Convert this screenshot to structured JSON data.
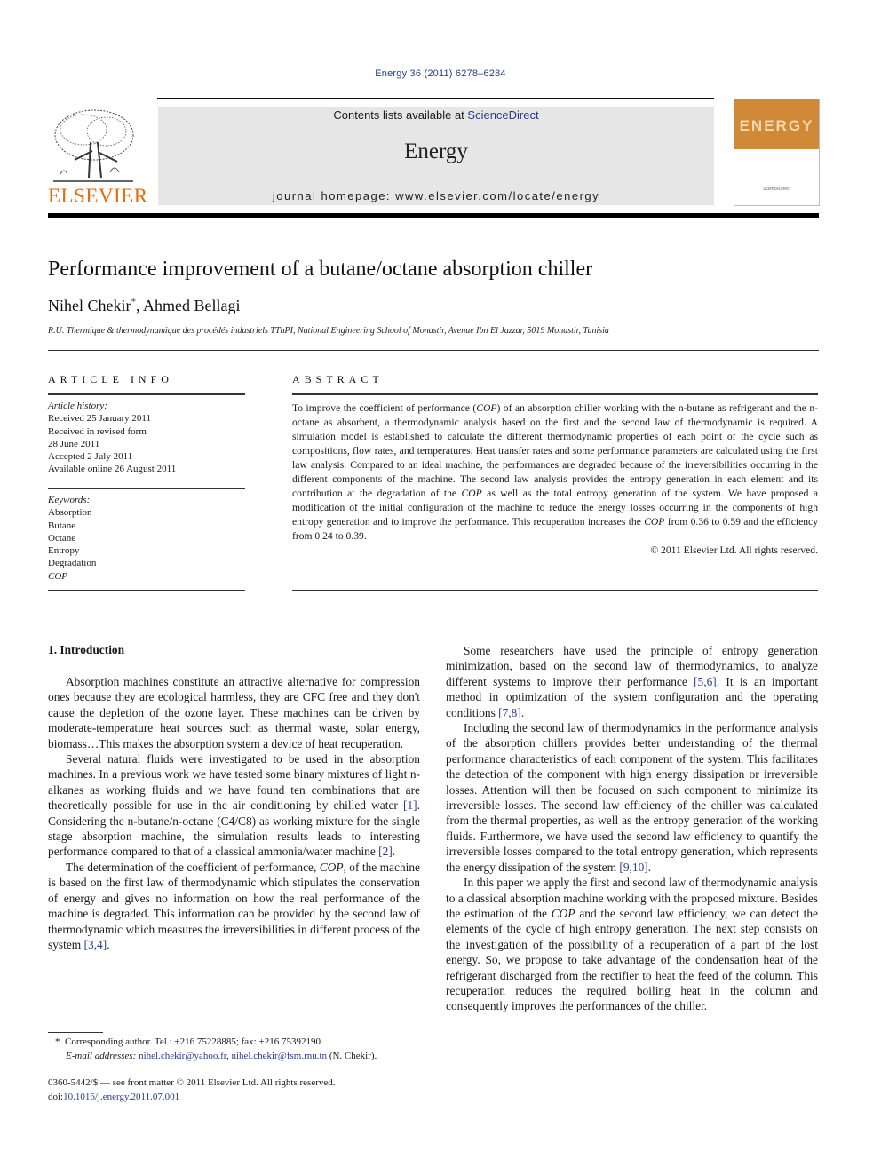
{
  "header": {
    "citation": "Energy 36 (2011) 6278–6284",
    "contents_prefix": "Contents lists available at ",
    "contents_link": "ScienceDirect",
    "journal_name": "Energy",
    "homepage": "journal homepage: www.elsevier.com/locate/energy",
    "publisher_logo_text": "ELSEVIER",
    "cover_title": "ENERGY"
  },
  "article": {
    "title": "Performance improvement of a butane/octane absorption chiller",
    "authors": [
      {
        "name": "Nihel Chekir",
        "mark": "*"
      },
      {
        "name": "Ahmed Bellagi",
        "mark": ""
      }
    ],
    "author_separator": ", ",
    "affiliation": "R.U. Thermique & thermodynamique des procédés industriels TThPI, National Engineering School of Monastir, Avenue Ibn El Jazzar, 5019 Monastir, Tunisia"
  },
  "article_info": {
    "heading": "ARTICLE INFO",
    "history_label": "Article history:",
    "history": [
      "Received 25 January 2011",
      "Received in revised form",
      "28 June 2011",
      "Accepted 2 July 2011",
      "Available online 26 August 2011"
    ],
    "keywords_label": "Keywords:",
    "keywords": [
      "Absorption",
      "Butane",
      "Octane",
      "Entropy",
      "Degradation",
      "COP"
    ]
  },
  "abstract": {
    "heading": "ABSTRACT",
    "parts": [
      "To improve the coefficient of performance (",
      "COP",
      ") of an absorption chiller working with the n-butane as refrigerant and the n-octane as absorbent, a thermodynamic analysis based on the first and the second law of thermodynamic is required. A simulation model is established to calculate the different ther­modynamic properties of each point of the cycle such as compositions, flow rates, and temperatures. Heat transfer rates and some performance parameters are calculated using the first law analysis. Compared to an ideal machine, the performances are degraded because of the irreversibilities occurring in the different components of the machine. The second law analysis provides the entropy generation in each element and its contribution at the degradation of the ",
      "COP",
      " as well as the total entropy generation of the system. We have proposed a modification of the initial configuration of the machine to reduce the energy losses occurring in the components of high entropy generation and to improve the performance. This recuperation increases the ",
      "COP",
      " from 0.36 to 0.59 and the efficiency from 0.24 to 0.39."
    ],
    "copyright": "© 2011 Elsevier Ltd. All rights reserved."
  },
  "introduction": {
    "heading": "1.  Introduction",
    "left_paragraphs": [
      {
        "segments": [
          {
            "t": "Absorption machines constitute an attractive alternative for compression ones because they are ecological harmless, they are CFC free and they don't cause the depletion of the ozone layer. These machines can be driven by moderate-temperature heat sources such as thermal waste, solar energy, biomass…This makes the absorption system a device of heat recuperation."
          }
        ]
      },
      {
        "segments": [
          {
            "t": "Several natural fluids were investigated to be used in the absorption machines. In a previous work we have tested some binary mixtures of light n-alkanes as working fluids and we have found ten combinations that are theoretically possible for use in the air conditioning by chilled water "
          },
          {
            "t": "[1]",
            "link": true
          },
          {
            "t": ". Considering the n-butane/n-octane (C4/C8) as working mixture for the single stage absorption machine, the simulation results leads to interesting performance compared to that of a classical ammonia/water machine "
          },
          {
            "t": "[2]",
            "link": true
          },
          {
            "t": "."
          }
        ]
      },
      {
        "segments": [
          {
            "t": "The determination of the coefficient of performance, "
          },
          {
            "t": "COP",
            "italic": true
          },
          {
            "t": ", of the machine is based on the first law of thermodynamic which stip­ulates the conservation of energy and gives no information on how the real performance of the machine is degraded. This information can be provided by the second law of thermodynamic which measures the irreversibilities in different process of the system "
          },
          {
            "t": "[3,4]",
            "link": true
          },
          {
            "t": "."
          }
        ]
      }
    ],
    "right_paragraphs": [
      {
        "segments": [
          {
            "t": "Some researchers have used the principle of entropy generation minimization, based on the second law of thermodynamics, to analyze different systems to improve their performance "
          },
          {
            "t": "[5,6]",
            "link": true
          },
          {
            "t": ". It is an important method in optimization of the system configuration and the operating conditions "
          },
          {
            "t": "[7,8]",
            "link": true
          },
          {
            "t": "."
          }
        ]
      },
      {
        "segments": [
          {
            "t": "Including the second law of thermodynamics in the perfor­mance analysis of the absorption chillers provides better under­standing of the thermal performance characteristics of each component of the system. This facilitates the detection of the component with high energy dissipation or irreversible losses. Attention will then be focused on such component to minimize its irreversible losses. The second law efficiency of the chiller was calculated from the thermal properties, as well as the entropy generation of the working fluids. Furthermore, we have used the second law efficiency to quantify the irreversible losses compared to the total entropy generation, which represents the energy dissipation of the system "
          },
          {
            "t": "[9,10]",
            "link": true
          },
          {
            "t": "."
          }
        ]
      },
      {
        "segments": [
          {
            "t": "In this paper we apply the first and second law of thermody­namic analysis to a classical absorption machine working with the proposed mixture. Besides the estimation of the "
          },
          {
            "t": "COP",
            "italic": true
          },
          {
            "t": " and the second law efficiency, we can detect the elements of the cycle of high entropy generation. The next step consists on the investigation of the possibility of a recuperation of a part of the lost energy. So, we propose to take advantage of the condensation heat of the refrigerant discharged from the rectifier to heat the feed of the column. This recuperation reduces the required boiling heat in the column and consequently improves the performances of the chiller."
          }
        ]
      }
    ]
  },
  "footnote": {
    "mark": "*",
    "corresponding": "Corresponding author. Tel.: +216 75228885; fax: +216 75392190.",
    "email_label": "E-mail addresses:",
    "emails": [
      "nihel.chekir@yahoo.fr",
      "nihel.chekir@fsm.rnu.tn"
    ],
    "email_owner": "(N. Chekir)."
  },
  "front_matter": {
    "issn_line": "0360-5442/$ — see front matter © 2011 Elsevier Ltd. All rights reserved.",
    "doi_label": "doi:",
    "doi": "10.1016/j.energy.2011.07.001"
  },
  "colors": {
    "link": "#2a3b8f",
    "elsevier_orange": "#e46c0a",
    "header_band": "#e6e6e6",
    "cover_orange": "#d08a37"
  }
}
